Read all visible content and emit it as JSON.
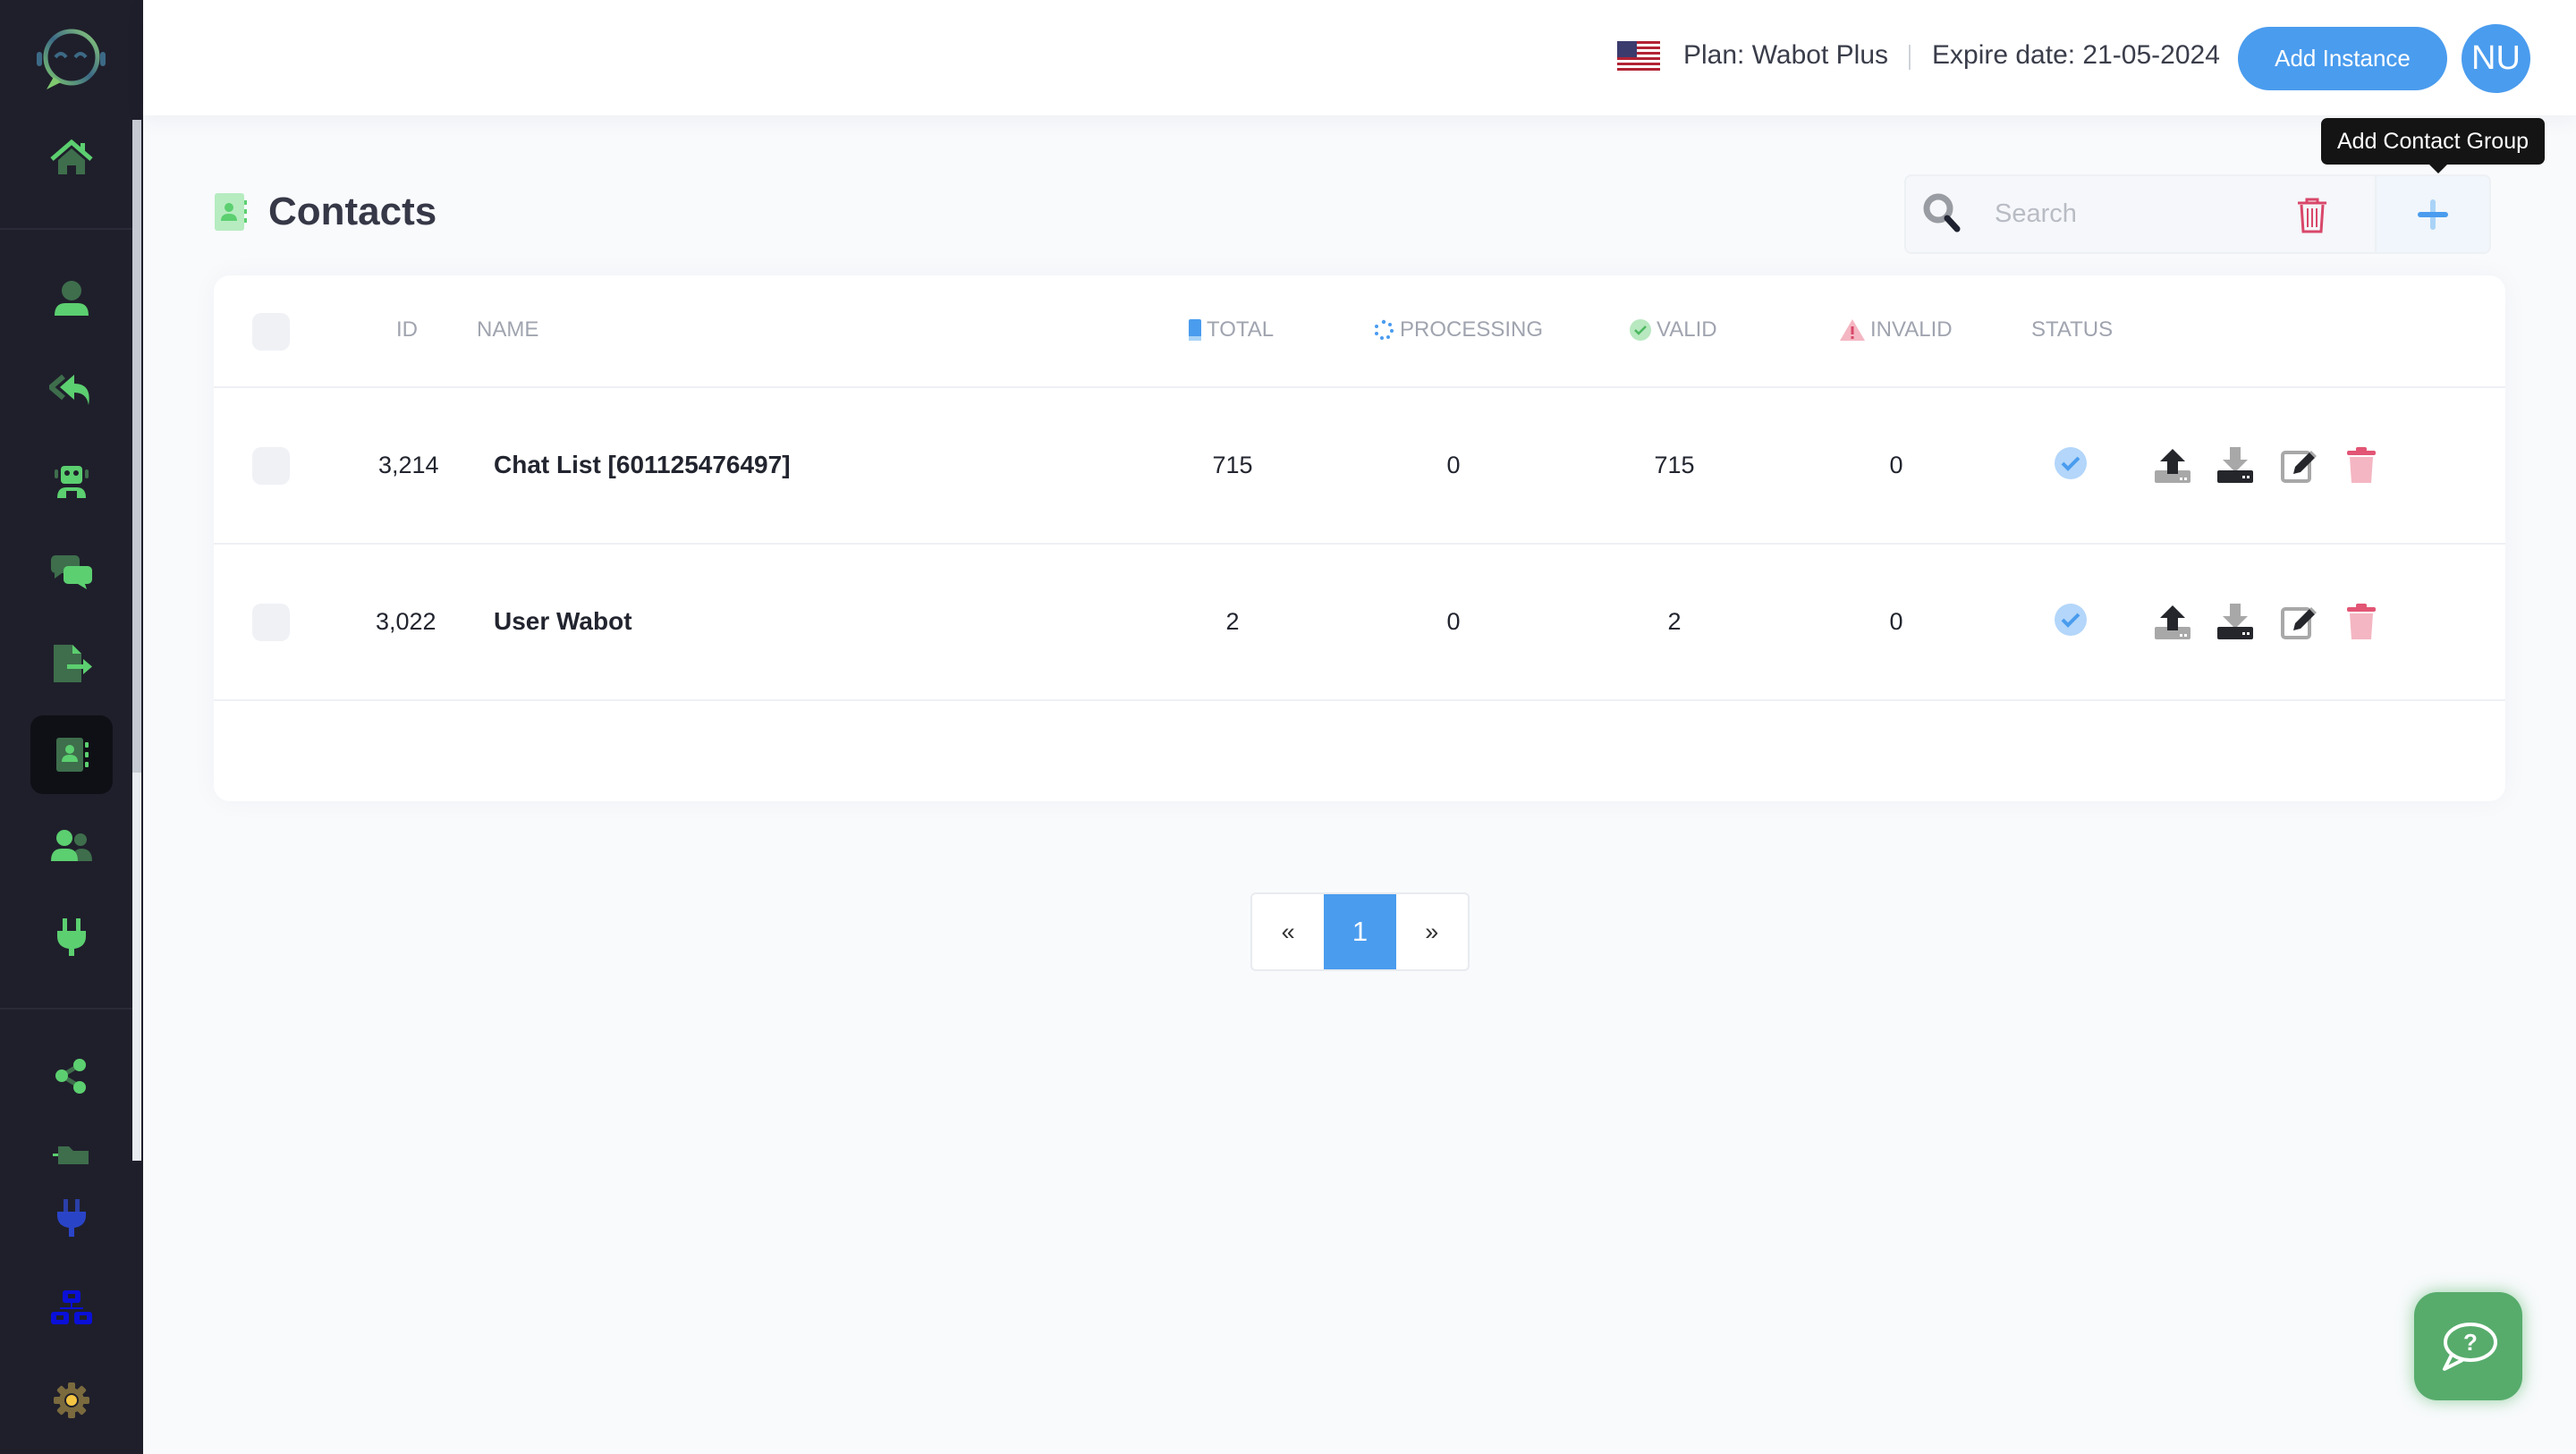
{
  "sidebar": {
    "logo": "wabot-chat-bot-logo",
    "items": [
      {
        "name": "home",
        "icon": "home-icon",
        "active": false
      },
      {
        "name": "profile",
        "icon": "user-icon",
        "active": false
      },
      {
        "name": "auto-reply",
        "icon": "reply-all-icon",
        "active": false
      },
      {
        "name": "chatbot",
        "icon": "robot-icon",
        "active": false
      },
      {
        "name": "chats",
        "icon": "comments-icon",
        "active": false
      },
      {
        "name": "export",
        "icon": "file-export-icon",
        "active": false
      },
      {
        "name": "contacts",
        "icon": "address-book-icon",
        "active": true
      },
      {
        "name": "users",
        "icon": "user-group-icon",
        "active": false
      },
      {
        "name": "integrations",
        "icon": "plug-icon",
        "active": false
      },
      {
        "name": "share",
        "icon": "share-nodes-icon",
        "active": false
      },
      {
        "name": "folder",
        "icon": "folder-icon",
        "active": false
      },
      {
        "name": "plugin",
        "icon": "plug-blue-icon",
        "active": false
      },
      {
        "name": "network",
        "icon": "sitemap-icon",
        "active": false
      },
      {
        "name": "settings",
        "icon": "gear-icon",
        "active": false
      }
    ]
  },
  "header": {
    "flag": "us-flag-icon",
    "plan": "Plan: Wabot Plus",
    "expire": "Expire date: 21-05-2024",
    "add_instance": "Add Instance",
    "avatar_initials": "NU",
    "accent": "#4a9cee"
  },
  "page": {
    "title": "Contacts",
    "search_placeholder": "Search",
    "search_value": "",
    "tooltip": "Add Contact Group"
  },
  "table": {
    "columns": {
      "id": "ID",
      "name": "NAME",
      "total": "TOTAL",
      "processing": "PROCESSING",
      "valid": "VALID",
      "invalid": "INVALID",
      "status": "STATUS"
    },
    "rows": [
      {
        "id": "3,214",
        "name": "Chat List [601125476497]",
        "total": "715",
        "processing": "0",
        "valid": "715",
        "invalid": "0",
        "status": "active"
      },
      {
        "id": "3,022",
        "name": "User Wabot",
        "total": "2",
        "processing": "0",
        "valid": "2",
        "invalid": "0",
        "status": "active"
      }
    ]
  },
  "pagination": {
    "prev": "«",
    "current": "1",
    "next": "»"
  },
  "help": {
    "icon": "help-chat-icon"
  }
}
